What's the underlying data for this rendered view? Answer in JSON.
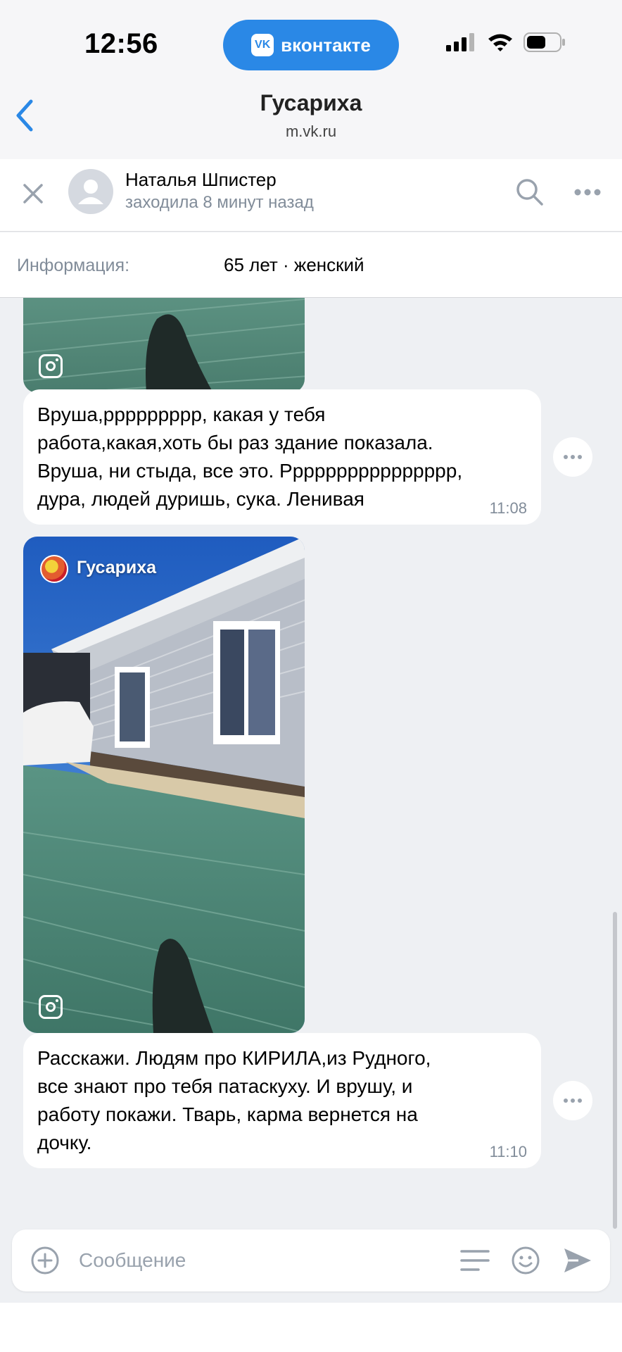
{
  "status_bar": {
    "time": "12:56",
    "app_pill": "вконтакте",
    "vk_logo": "VK"
  },
  "browser": {
    "title": "Гусариха",
    "url": "m.vk.ru"
  },
  "chat_header": {
    "name": "Наталья Шпистер",
    "status": "заходила 8 минут назад"
  },
  "info": {
    "label": "Информация:",
    "value": "65 лет · женский"
  },
  "messages": [
    {
      "text": "Вруша,ррррррррр, какая у тебя\nработа,какая,хоть бы раз здание показала.\nВруша, ни стыда,   все это. Рррррррррррррррр,\nдура, людей дуришь,  сука. Ленивая",
      "time": "11:08"
    },
    {
      "story_author": "Гусариха",
      "text": "Расскажи. Людям про КИРИЛА,из Рудного,\nвсе знают про тебя патаскуху.  И врушу,   и\nработу покажи.   Тварь,   карма вернется на\nдочку.",
      "time": "11:10"
    }
  ],
  "composer": {
    "placeholder": "Сообщение"
  },
  "colors": {
    "accent": "#2a88e6",
    "secondary_text": "#818c99",
    "background": "#eef0f3"
  }
}
